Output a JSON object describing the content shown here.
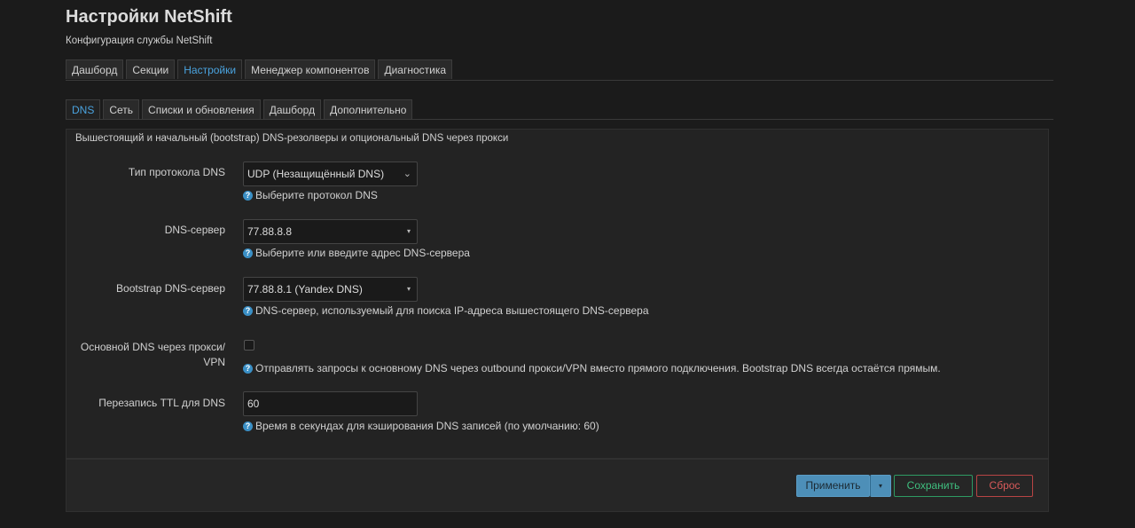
{
  "header": {
    "title": "Настройки NetShift",
    "subtitle": "Конфигурация службы NetShift"
  },
  "top_tabs": [
    "Дашборд",
    "Секции",
    "Настройки",
    "Менеджер компонентов",
    "Диагностика"
  ],
  "top_tabs_active": "Настройки",
  "sub_tabs": [
    "DNS",
    "Сеть",
    "Списки и обновления",
    "Дашборд",
    "Дополнительно"
  ],
  "sub_tabs_active": "DNS",
  "panel": {
    "description": "Вышестоящий и начальный (bootstrap) DNS-резолверы и опциональный DNS через прокси",
    "fields": {
      "protocol": {
        "label": "Тип протокола DNS",
        "value": "UDP (Незащищённый DNS)",
        "hint": "Выберите протокол DNS"
      },
      "server": {
        "label": "DNS-сервер",
        "value": "77.88.8.8",
        "hint": "Выберите или введите адрес DNS-сервера"
      },
      "bootstrap": {
        "label": "Bootstrap DNS-сервер",
        "value": "77.88.8.1 (Yandex DNS)",
        "hint": "DNS-сервер, используемый для поиска IP-адреса вышестоящего DNS-сервера"
      },
      "via_proxy": {
        "label_line1": "Основной DNS через прокси/",
        "label_line2": "VPN",
        "checked": false,
        "hint": "Отправлять запросы к основному DNS через outbound прокси/VPN вместо прямого подключения. Bootstrap DNS всегда остаётся прямым."
      },
      "ttl": {
        "label": "Перезапись TTL для DNS",
        "value": "60",
        "hint": "Время в секундах для кэширования DNS записей (по умолчанию: 60)"
      }
    }
  },
  "footer": {
    "apply_label": "Применить",
    "apply_dropdown": "▾",
    "save_label": "Сохранить",
    "reset_label": "Сброс"
  },
  "icons": {
    "help": "?",
    "select_caret": "▾",
    "select_chevron": "⌄"
  },
  "colors": {
    "accent": "#4aa3df",
    "apply_bg": "#4d8fb8",
    "save": "#3fbf7f",
    "reset": "#d85a5a"
  }
}
